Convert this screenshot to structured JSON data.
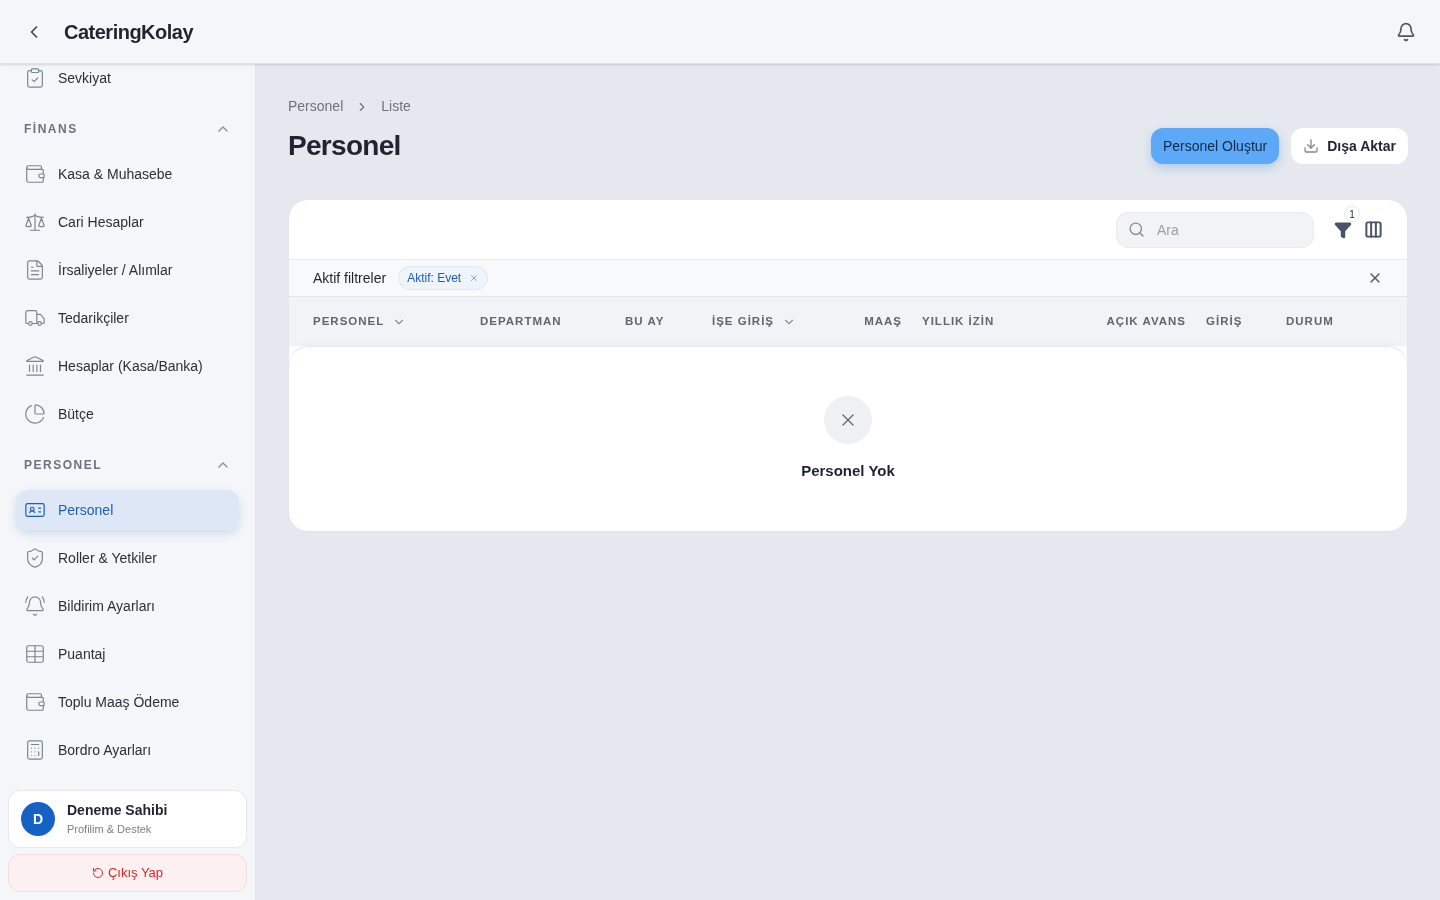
{
  "header": {
    "title": "CateringKolay"
  },
  "sidebar": {
    "top_items": [
      {
        "label": "Sevkiyat",
        "selected": false
      }
    ],
    "sections": [
      {
        "title": "FİNANS",
        "expanded": true,
        "items": [
          {
            "label": "Kasa & Muhasebe",
            "selected": false
          },
          {
            "label": "Cari Hesaplar",
            "selected": false
          },
          {
            "label": "İrsaliyeler / Alımlar",
            "selected": false
          },
          {
            "label": "Tedarikçiler",
            "selected": false
          },
          {
            "label": "Hesaplar (Kasa/Banka)",
            "selected": false
          },
          {
            "label": "Bütçe",
            "selected": false
          }
        ]
      },
      {
        "title": "PERSONEL",
        "expanded": true,
        "items": [
          {
            "label": "Personel",
            "selected": true
          },
          {
            "label": "Roller & Yetkiler",
            "selected": false
          },
          {
            "label": "Bildirim Ayarları",
            "selected": false
          },
          {
            "label": "Puantaj",
            "selected": false
          },
          {
            "label": "Toplu Maaş Ödeme",
            "selected": false
          },
          {
            "label": "Bordro Ayarları",
            "selected": false
          }
        ]
      }
    ]
  },
  "user": {
    "initial": "D",
    "name": "Deneme Sahibi",
    "subtitle": "Profilim & Destek"
  },
  "logout": "Çıkış Yap",
  "breadcrumb": [
    "Personel",
    "Liste"
  ],
  "page_title": "Personel",
  "actions": {
    "primary": "Personel Oluştur",
    "export": "Dışa Aktar"
  },
  "search": {
    "placeholder": "Ara"
  },
  "filter_count": "1",
  "active_filters": {
    "label": "Aktif filtreler",
    "chips": [
      "Aktif: Evet"
    ]
  },
  "columns": [
    {
      "label": "PERSONEL",
      "sortable": true
    },
    {
      "label": "DEPARTMAN",
      "sortable": false
    },
    {
      "label": "BU AY",
      "sortable": false
    },
    {
      "label": "İŞE GİRİŞ",
      "sortable": true
    },
    {
      "label": "MAAŞ",
      "sortable": false
    },
    {
      "label": "YILLIK İZİN",
      "sortable": false
    },
    {
      "label": "AÇIK AVANS",
      "sortable": false
    },
    {
      "label": "GİRİŞ",
      "sortable": false
    },
    {
      "label": "DURUM",
      "sortable": false
    }
  ],
  "empty": {
    "text": "Personel Yok"
  }
}
